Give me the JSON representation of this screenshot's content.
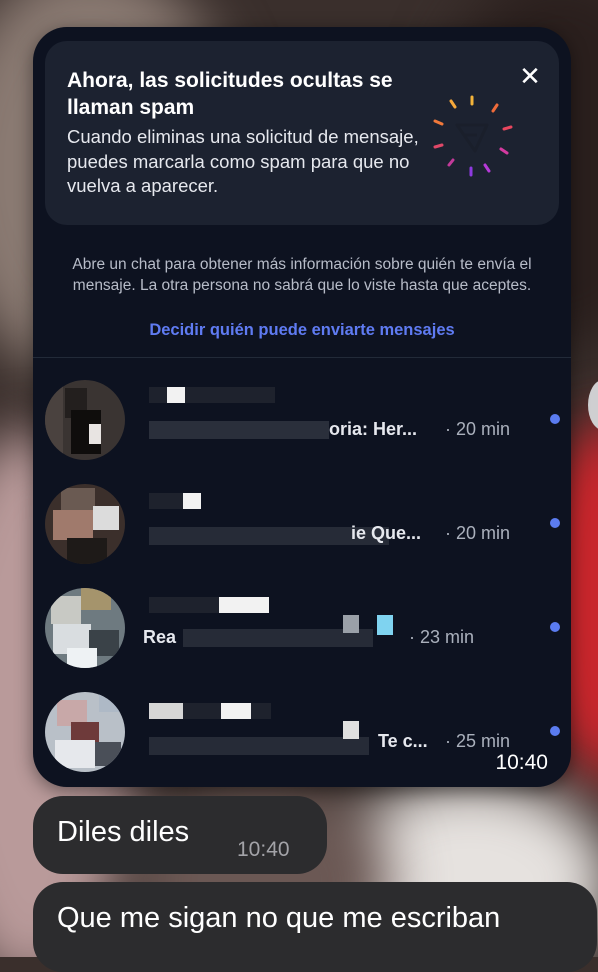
{
  "notice": {
    "title": "Ahora, las solicitudes ocultas se llaman spam",
    "body": "Cuando eliminas una solicitud de mensaje, puedes marcarla como spam para que no vuelva a aparecer.",
    "close_icon": "close-icon"
  },
  "info_text": "Abre un chat para obtener más información sobre quién te envía el mensaje. La otra persona no sabrá que lo viste hasta que aceptes.",
  "settings_link": "Decidir quién puede enviarte mensajes",
  "requests": [
    {
      "snippet": "oria: Her...",
      "time": "· 20 min",
      "unread": true
    },
    {
      "snippet": "ie Que...",
      "time": "· 20 min",
      "unread": true
    },
    {
      "snippet": "Rea",
      "time": "· 23 min",
      "unread": true
    },
    {
      "snippet": "Te c...",
      "time": "· 25 min",
      "unread": true
    }
  ],
  "card_timestamp": "10:40",
  "messages": [
    {
      "text": "Diles diles",
      "time": "10:40"
    },
    {
      "text": "Que me sigan no que me escriban"
    }
  ],
  "colors": {
    "card_bg": "#0d1220",
    "banner_bg": "#1c2230",
    "link": "#5f7bf2",
    "unread_dot": "#5b7cf0",
    "bubble_bg": "#2c2c2e"
  }
}
